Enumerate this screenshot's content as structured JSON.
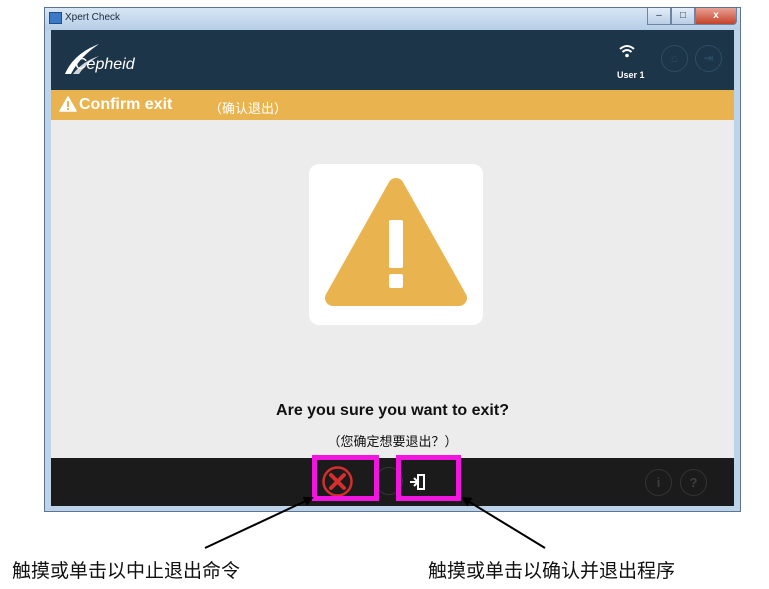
{
  "window": {
    "title": "Xpert Check",
    "buttons": {
      "minimize": "–",
      "maximize": "□",
      "close": "x"
    }
  },
  "header": {
    "logo_text": "Cepheid",
    "user": "User 1",
    "icons": [
      "wifi-icon",
      "home-icon",
      "logout-icon"
    ]
  },
  "banner": {
    "title": "Confirm exit",
    "subtitle": "（确认退出）",
    "color": "#e9b44f"
  },
  "dialog": {
    "icon": "warning-icon",
    "question": "Are you sure you want to exit?",
    "question_cn": "（您确定想要退出？）"
  },
  "footer": {
    "buttons": [
      "cancel-icon",
      "exit-icon",
      "info-icon",
      "help-icon"
    ],
    "info_label": "i",
    "help_label": "?"
  },
  "annotations": {
    "left": "触摸或单击以中止退出命令",
    "right": "触摸或单击以确认并退出程序",
    "highlight_color": "#f215e0"
  },
  "colors": {
    "header": "#1c3548",
    "footer": "#1b1b1b",
    "cancel_red": "#d62e2e",
    "body": "#ececec"
  }
}
